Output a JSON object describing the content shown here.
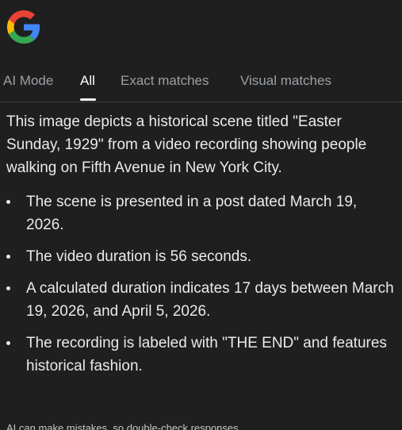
{
  "tabs": [
    {
      "label": "AI Mode"
    },
    {
      "label": "All"
    },
    {
      "label": "Exact matches"
    },
    {
      "label": "Visual matches"
    }
  ],
  "active_tab": "All",
  "logo_icon": "google-g-icon",
  "colors": {
    "background": "#1f1f1f",
    "text": "#e8eaed",
    "tab_inactive": "#9aa0a6",
    "tab_active": "#ffffff"
  },
  "summary": "This image depicts a historical scene titled \"Easter Sunday, 1929\" from a video recording showing people walking on Fifth Avenue in New York City.",
  "bullets": [
    "The scene is presented in a post dated March 19, 2026.",
    "The video duration is 56 seconds.",
    "A calculated duration indicates 17 days between March 19, 2026, and April 5, 2026.",
    "The recording is labeled with \"THE END\" and features historical fashion."
  ],
  "disclaimer": "AI can make mistakes, so double-check responses"
}
